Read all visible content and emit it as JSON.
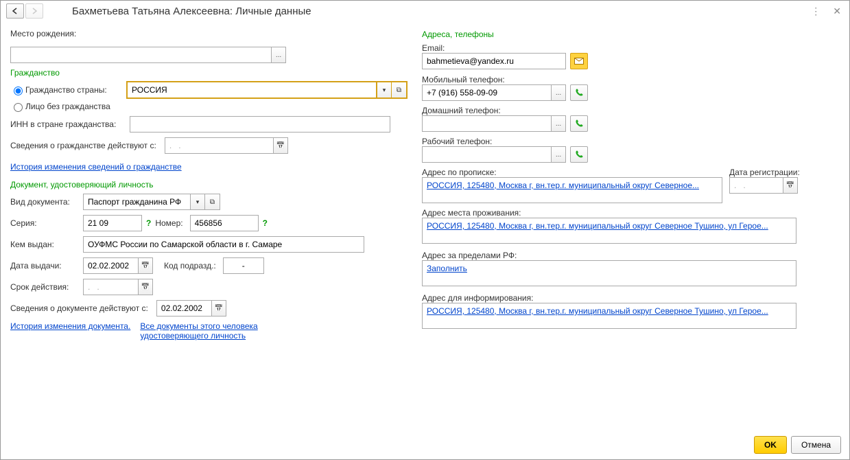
{
  "title": "Бахметьева Татьяна Алексеевна: Личные данные",
  "birthplace_label": "Место рождения:",
  "birthplace_value": "",
  "citizenship_header": "Гражданство",
  "citizenship_country_label": "Гражданство страны:",
  "citizenship_country_value": "РОССИЯ",
  "stateless_label": "Лицо без гражданства",
  "inn_label": "ИНН в стране гражданства:",
  "inn_value": "",
  "citizenship_valid_from_label": "Сведения о гражданстве действуют с:",
  "citizenship_date_placeholder": ".   .",
  "citizenship_history_link": "История изменения сведений о гражданстве",
  "doc_header": "Документ, удостоверяющий личность",
  "doc_type_label": "Вид документа:",
  "doc_type_value": "Паспорт гражданина РФ",
  "series_label": "Серия:",
  "series_value": "21 09",
  "number_label": "Номер:",
  "number_value": "456856",
  "issued_by_label": "Кем выдан:",
  "issued_by_value": "ОУФМС России по Самарской области в г. Самаре",
  "issue_date_label": "Дата выдачи:",
  "issue_date_value": "02.02.2002",
  "dept_code_label": "Код подразд.:",
  "dept_code_value": "-",
  "validity_label": "Срок действия:",
  "validity_placeholder": ".   .",
  "doc_valid_from_label": "Сведения о документе действуют с:",
  "doc_valid_from_value": "02.02.2002",
  "doc_history_link": "История изменения документа.",
  "all_docs_link": "Все документы этого человека удостоверяющего личность",
  "contacts_header": "Адреса, телефоны",
  "email_label": "Email:",
  "email_value": "bahmetieva@yandex.ru",
  "mobile_label": "Мобильный телефон:",
  "mobile_value": "+7 (916) 558-09-09",
  "home_phone_label": "Домашний телефон:",
  "home_phone_value": "",
  "work_phone_label": "Рабочий телефон:",
  "work_phone_value": "",
  "reg_addr_label": "Адрес по прописке:",
  "reg_date_label": "Дата регистрации:",
  "reg_date_placeholder": ".   .",
  "reg_addr_value": "РОССИЯ, 125480, Москва г, вн.тер.г. муниципальный округ Северное...",
  "res_addr_label": "Адрес места проживания:",
  "res_addr_value": "РОССИЯ, 125480, Москва г, вн.тер.г. муниципальный округ Северное Тушино, ул Герое...",
  "foreign_addr_label": "Адрес за пределами РФ:",
  "fill_link": "Заполнить",
  "notify_addr_label": "Адрес для информирования:",
  "notify_addr_value": "РОССИЯ, 125480, Москва г, вн.тер.г. муниципальный округ Северное Тушино, ул Герое...",
  "ok_label": "OK",
  "cancel_label": "Отмена",
  "help_mark": "?",
  "ellipsis": "..."
}
